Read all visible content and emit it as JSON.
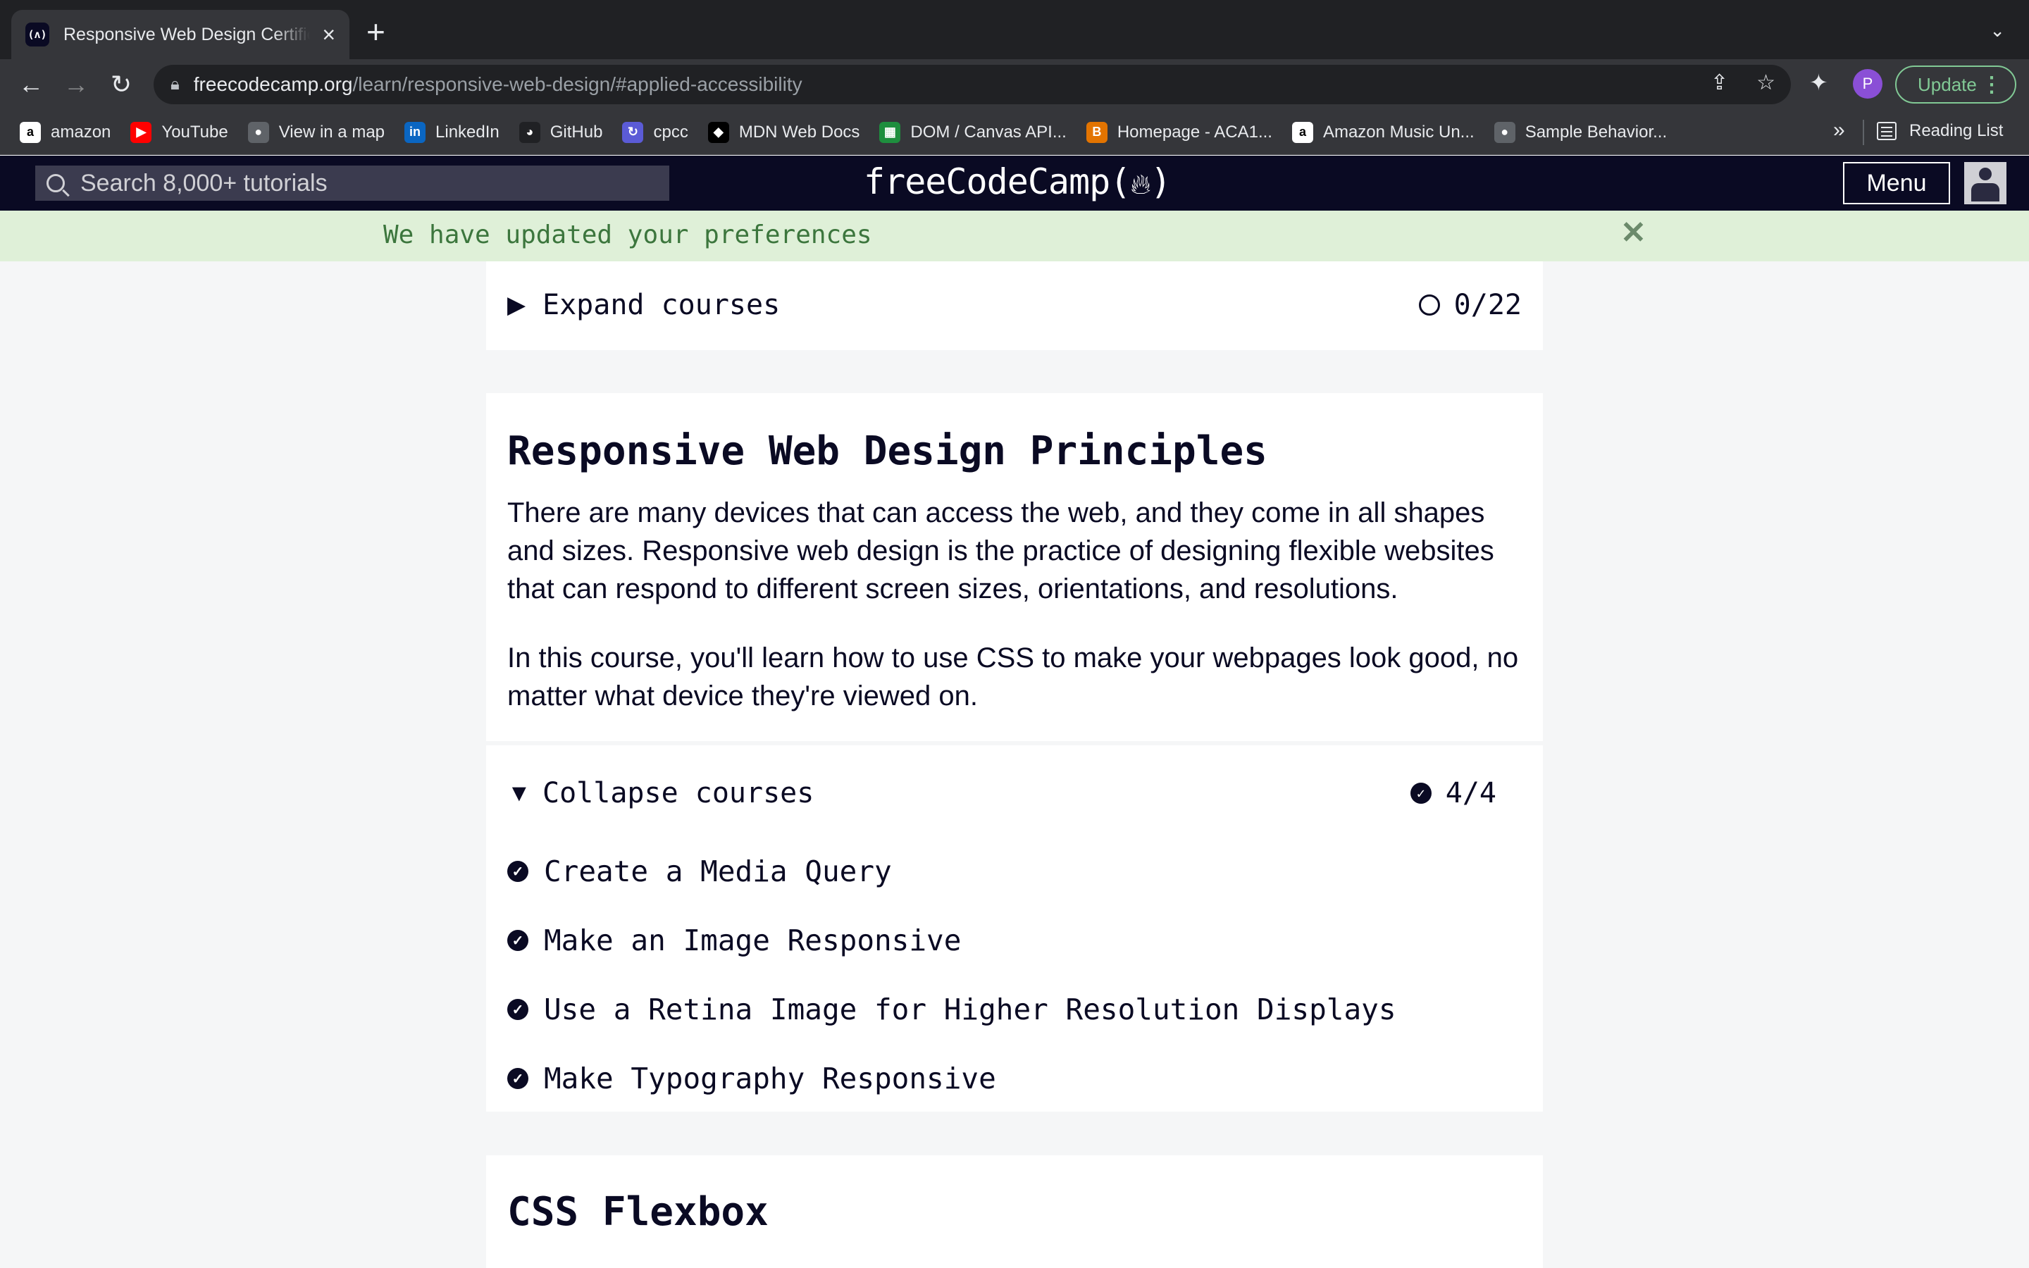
{
  "browser": {
    "tab_title": "Responsive Web Design Certification",
    "tab_favicon": "(ʌ)",
    "url_host": "freecodecamp.org",
    "url_path": "/learn/responsive-web-design/#applied-accessibility",
    "update_label": "Update",
    "profile_initial": "P",
    "bookmarks": [
      {
        "label": "amazon",
        "icon": "amazon-icon",
        "color": "#ffffff",
        "glyph": "a"
      },
      {
        "label": "YouTube",
        "icon": "youtube-icon",
        "color": "#ff0000",
        "glyph": "▶"
      },
      {
        "label": "View in a map",
        "icon": "globe-icon",
        "color": "#5f6368",
        "glyph": "●"
      },
      {
        "label": "LinkedIn",
        "icon": "linkedin-icon",
        "color": "#0a66c2",
        "glyph": "in"
      },
      {
        "label": "GitHub",
        "icon": "github-icon",
        "color": "#202124",
        "glyph": "◕"
      },
      {
        "label": "cpcc",
        "icon": "cpcc-icon",
        "color": "#5b5bd6",
        "glyph": "↻"
      },
      {
        "label": "MDN Web Docs",
        "icon": "mdn-icon",
        "color": "#000000",
        "glyph": "◆"
      },
      {
        "label": "DOM / Canvas API...",
        "icon": "sheet-icon",
        "color": "#1e8e3e",
        "glyph": "▦"
      },
      {
        "label": "Homepage - ACA1...",
        "icon": "aca-icon",
        "color": "#e37400",
        "glyph": "B"
      },
      {
        "label": "Amazon Music Un...",
        "icon": "amazon-icon",
        "color": "#ffffff",
        "glyph": "a"
      },
      {
        "label": "Sample Behavior...",
        "icon": "globe-icon",
        "color": "#5f6368",
        "glyph": "●"
      }
    ],
    "bookmarks_more": "»",
    "reading_list": "Reading List"
  },
  "fcc": {
    "search_placeholder": "Search 8,000+ tutorials",
    "logo": "freeCodeCamp(ὒ5)",
    "logo_text": "freeCodeCamp",
    "menu_label": "Menu"
  },
  "flash": {
    "message": "We have updated your preferences",
    "close": "✕"
  },
  "previous_block": {
    "toggle_label": "Expand courses",
    "progress": "0/22"
  },
  "rwd_block": {
    "title": "Responsive Web Design Principles",
    "paragraphs": [
      "There are many devices that can access the web, and they come in all shapes and sizes. Responsive web design is the practice of designing flexible websites that can respond to different screen sizes, orientations, and resolutions.",
      "In this course, you'll learn how to use CSS to make your webpages look good, no matter what device they're viewed on."
    ],
    "toggle_label": "Collapse courses",
    "progress": "4/4",
    "courses": [
      "Create a Media Query",
      "Make an Image Responsive",
      "Use a Retina Image for Higher Resolution Displays",
      "Make Typography Responsive"
    ]
  },
  "next_block": {
    "title": "CSS Flexbox"
  }
}
